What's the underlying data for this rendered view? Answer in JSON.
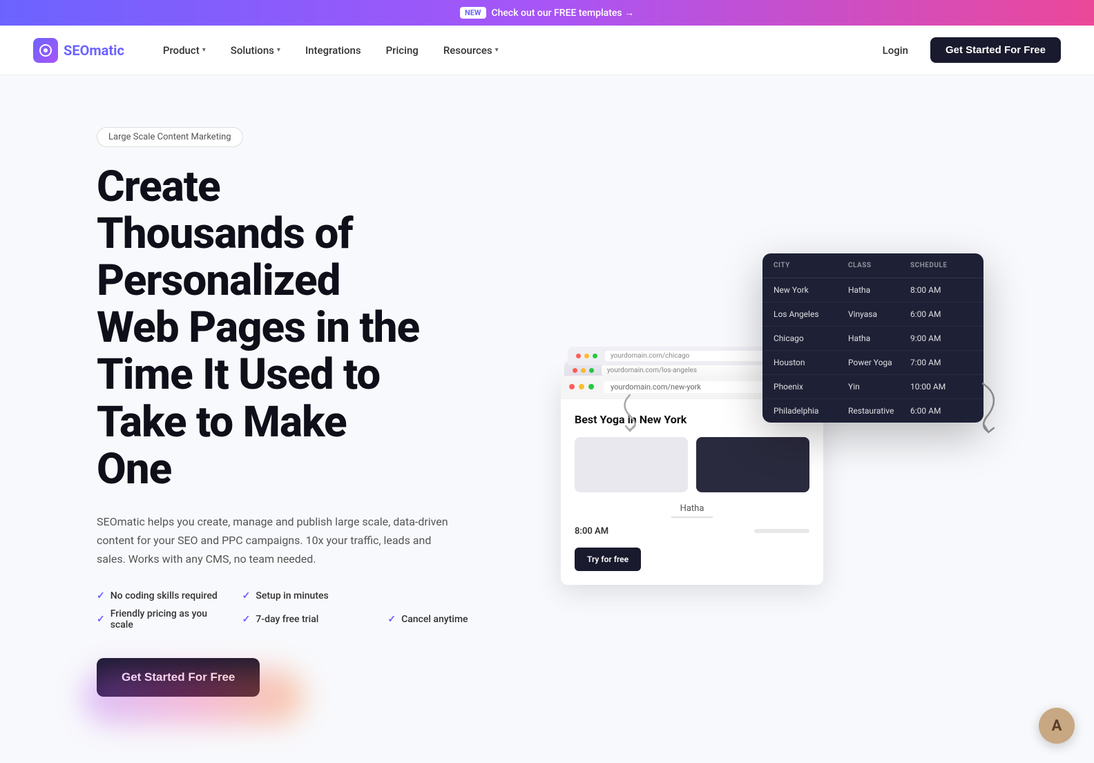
{
  "banner": {
    "badge": "NEW",
    "text": "Check out our FREE templates →"
  },
  "nav": {
    "logo_text_seo": "SEO",
    "logo_text_matic": "matic",
    "items": [
      {
        "label": "Product",
        "has_arrow": true
      },
      {
        "label": "Solutions",
        "has_arrow": true
      },
      {
        "label": "Integrations",
        "has_arrow": false
      },
      {
        "label": "Pricing",
        "has_arrow": false
      },
      {
        "label": "Resources",
        "has_arrow": true
      }
    ],
    "login": "Login",
    "cta": "Get Started For Free"
  },
  "hero": {
    "tag": "Large Scale Content Marketing",
    "title_line1": "Create",
    "title_line2": "Thousands of",
    "title_line3": "Personalized",
    "title_line4": "Web Pages in the",
    "title_line5": "Time It Used to",
    "title_line6": "Take to Make",
    "title_line7": "One",
    "description": "SEOmatic helps you create, manage and publish large scale, data-driven content for your SEO and PPC campaigns. 10x your traffic, leads and sales. Works with any CMS, no team needed.",
    "features": [
      "No coding skills required",
      "Setup in minutes",
      "Friendly pricing as you scale",
      "7-day free trial",
      "Cancel anytime"
    ],
    "cta": "Get Started For Free"
  },
  "data_table": {
    "headers": [
      "CITY",
      "CLASS",
      "SCHEDULE"
    ],
    "rows": [
      {
        "city": "New York",
        "class": "Hatha",
        "schedule": "8:00 AM"
      },
      {
        "city": "Los Angeles",
        "class": "Vinyasa",
        "schedule": "6:00 AM"
      },
      {
        "city": "Chicago",
        "class": "Hatha",
        "schedule": "9:00 AM"
      },
      {
        "city": "Houston",
        "class": "Power Yoga",
        "schedule": "7:00 AM"
      },
      {
        "city": "Phoenix",
        "class": "Yin",
        "schedule": "10:00 AM"
      },
      {
        "city": "Philadelphia",
        "class": "Restaurative",
        "schedule": "6:00 AM"
      }
    ]
  },
  "browser": {
    "url1": "yourdomain.com/chicago",
    "url2": "yourdomain.com/los-angeles",
    "url3": "yourdomain.com/new-york",
    "page_title": "Best Yoga in New York",
    "class_label": "Hatha",
    "time": "8:00 AM",
    "try_btn": "Try for free"
  },
  "avatar_initial": "A"
}
